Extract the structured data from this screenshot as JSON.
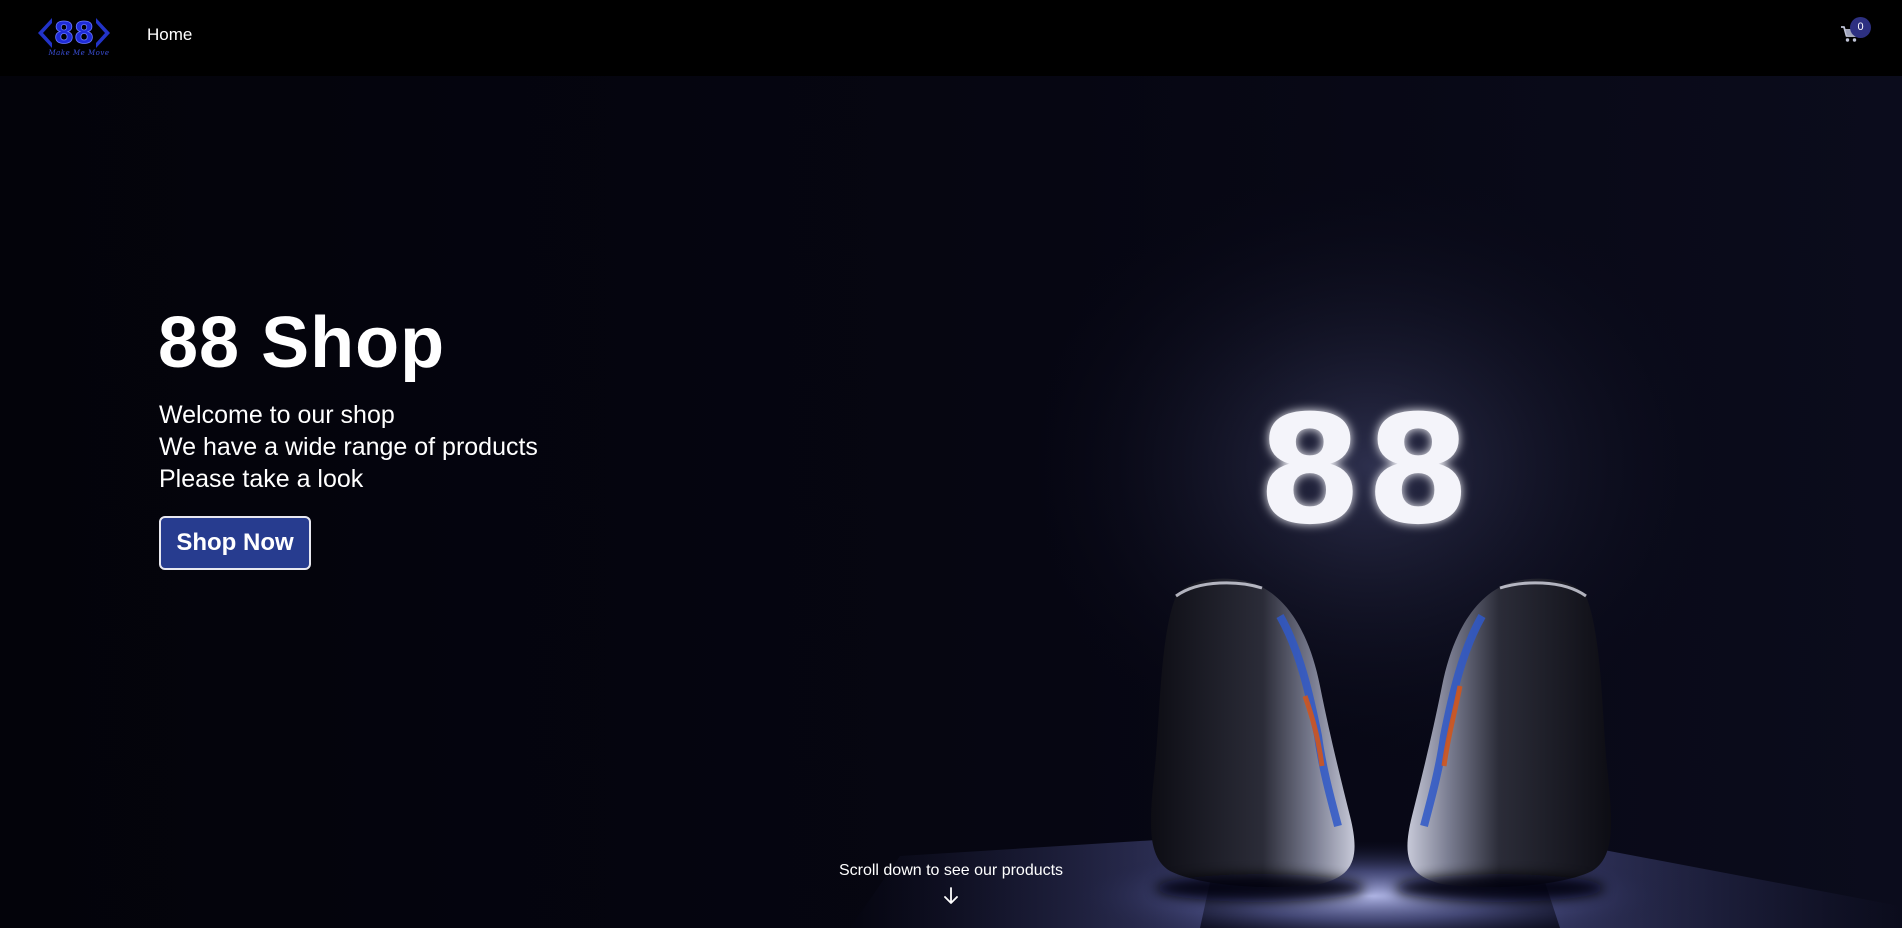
{
  "nav": {
    "logo_mark": "88",
    "logo_tagline": "Make Me Move",
    "home_label": "Home",
    "cart_icon": "shopping-cart-icon",
    "cart_count": "0"
  },
  "hero": {
    "title": "88 Shop",
    "lines": [
      "Welcome to our shop",
      "We have a wide range of products",
      "Please take a look"
    ],
    "cta_label": "Shop Now",
    "scroll_hint": "Scroll down to see our products",
    "scroll_icon": "arrow-down-icon",
    "image_text": "88"
  },
  "colors": {
    "background": "#04040a",
    "navbar": "#000000",
    "accent": "#273c8f",
    "badge": "#2d3081",
    "logo_blue": "#2f43e0"
  }
}
